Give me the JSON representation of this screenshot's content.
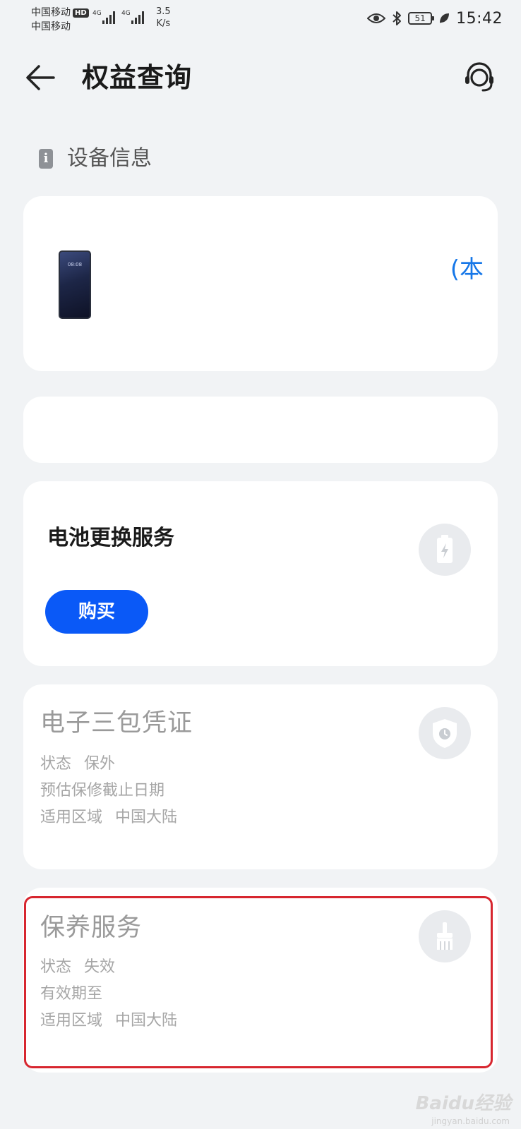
{
  "status_bar": {
    "carrier_1": "中国移动",
    "hd_badge": "HD",
    "carrier_2": "中国移动",
    "network_1": "4G",
    "network_2": "4G",
    "speed_value": "3.5",
    "speed_unit": "K/s",
    "battery_level": "51",
    "time": "15:42"
  },
  "app_bar": {
    "title": "权益查询"
  },
  "section": {
    "title": "设备信息",
    "icon_glyph": "i"
  },
  "device_card": {
    "name_partial": "(本"
  },
  "battery_service": {
    "title": "电池更换服务",
    "buy_label": "购买"
  },
  "warranty_card": {
    "title": "电子三包凭证",
    "rows": [
      {
        "label": "状态",
        "value": "保外"
      },
      {
        "label": "预估保修截止日期",
        "value": ""
      },
      {
        "label": "适用区域",
        "value": "中国大陆"
      }
    ]
  },
  "maintenance_card": {
    "title": "保养服务",
    "rows": [
      {
        "label": "状态",
        "value": "失效"
      },
      {
        "label": "有效期至",
        "value": ""
      },
      {
        "label": "适用区域",
        "value": "中国大陆"
      }
    ]
  },
  "watermark": {
    "brand": "Baidu经验",
    "url": "jingyan.baidu.com"
  },
  "colors": {
    "accent_blue": "#0A59F7",
    "link_blue": "#1677E8",
    "highlight_red": "#D7262F"
  },
  "icons": [
    "back-arrow-icon",
    "customer-service-icon",
    "info-icon",
    "battery-charging-icon",
    "shield-clock-icon",
    "brush-icon",
    "eye-icon",
    "bluetooth-icon",
    "leaf-icon",
    "signal-icon"
  ]
}
